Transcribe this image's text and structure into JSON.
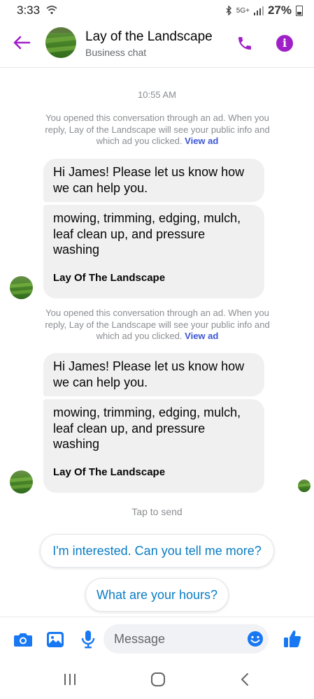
{
  "status_bar": {
    "time": "3:33",
    "network": "5G+",
    "battery": "27%"
  },
  "header": {
    "title": "Lay of the Landscape",
    "subtitle": "Business chat"
  },
  "chat": {
    "timestamp": "10:55 AM",
    "ad_notice": {
      "text": "You opened this conversation through an ad. When you reply, Lay of the Landscape will see your public info and which ad you clicked.",
      "link": "View ad"
    },
    "greeting": "Hi James! Please let us know how we can help you.",
    "services": "mowing, trimming, edging, mulch, leaf clean up, and pressure washing",
    "business_name": "Lay Of The Landscape",
    "tap_to_send": "Tap to send"
  },
  "quick_replies": [
    "I'm interested. Can you tell me more?",
    "What are your hours?"
  ],
  "composer": {
    "placeholder": "Message"
  },
  "colors": {
    "accent": "#a020c8",
    "brand_blue": "#1877f2",
    "link": "#0a7cc4",
    "bubble": "#f0f0f0"
  }
}
